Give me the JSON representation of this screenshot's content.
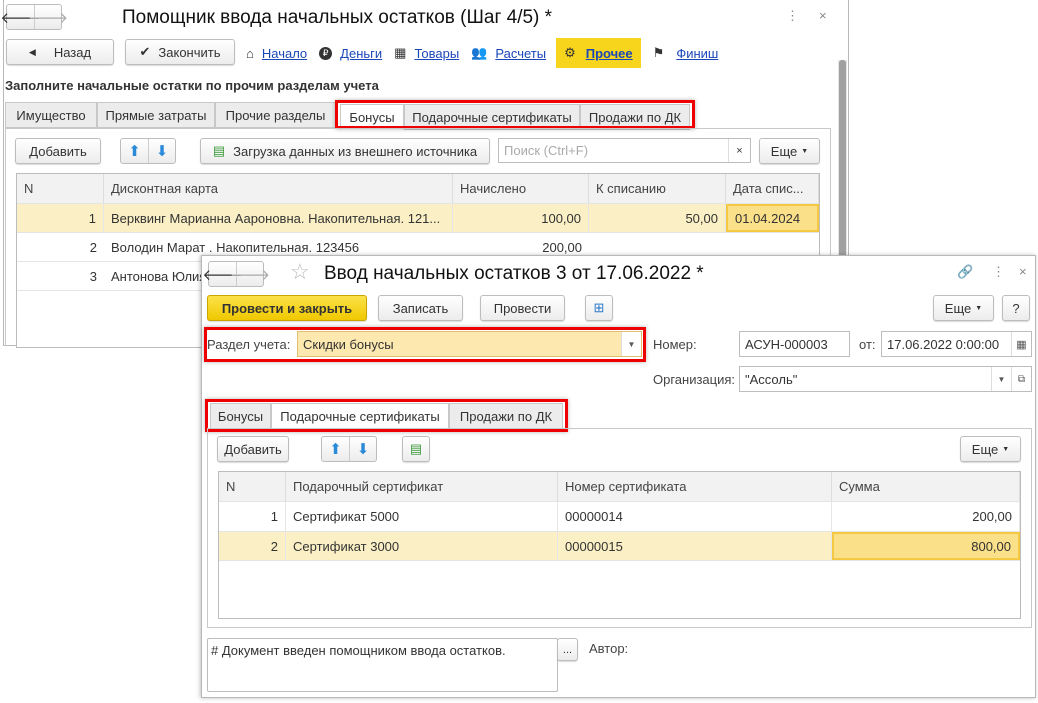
{
  "back": {
    "title": "Помощник ввода начальных остатков (Шаг 4/5) *",
    "back_btn": "Назад",
    "finish_btn": "Закончить",
    "steps": [
      {
        "label": "Начало",
        "icon": "home-icon"
      },
      {
        "label": "Деньги",
        "icon": "ruble-icon"
      },
      {
        "label": "Товары",
        "icon": "goods-icon"
      },
      {
        "label": "Расчеты",
        "icon": "people-icon"
      },
      {
        "label": "Прочее",
        "icon": "gear-icon",
        "active": true
      },
      {
        "label": "Финиш",
        "icon": "flag-icon"
      }
    ],
    "heading": "Заполните начальные остатки по прочим разделам учета",
    "tabs": [
      "Имущество",
      "Прямые затраты",
      "Прочие разделы",
      "Бонусы",
      "Подарочные сертификаты",
      "Продажи по ДК"
    ],
    "add_btn": "Добавить",
    "load_btn": "Загрузка данных из внешнего источника",
    "search_placeholder": "Поиск (Ctrl+F)",
    "more_btn": "Еще",
    "columns": [
      "N",
      "Дисконтная карта",
      "Начислено",
      "К списанию",
      "Дата спис..."
    ],
    "rows": [
      [
        "1",
        "Верквинг Марианна Аароновна. Накопительная. 121...",
        "100,00",
        "50,00",
        "01.04.2024"
      ],
      [
        "2",
        "Володин Марат . Накопительная. 123456",
        "200,00",
        "",
        ""
      ],
      [
        "3",
        "Антонова Юлия",
        "",
        "",
        ""
      ]
    ]
  },
  "front": {
    "title": "Ввод начальных остатков 3 от 17.06.2022 *",
    "post_close_btn": "Провести и закрыть",
    "save_btn": "Записать",
    "post_btn": "Провести",
    "more_btn": "Еще",
    "help_btn": "?",
    "section_label": "Раздел учета:",
    "section_value": "Скидки бонусы",
    "number_label": "Номер:",
    "number_value": "АСУН-000003",
    "date_label": "от:",
    "date_value": "17.06.2022  0:00:00",
    "org_label": "Организация:",
    "org_value": "\"Ассоль\"",
    "tabs": [
      "Бонусы",
      "Подарочные сертификаты",
      "Продажи по ДК"
    ],
    "add_btn": "Добавить",
    "columns": [
      "N",
      "Подарочный сертификат",
      "Номер сертификата",
      "Сумма"
    ],
    "rows": [
      [
        "1",
        "Сертификат 5000",
        "00000014",
        "200,00"
      ],
      [
        "2",
        "Сертификат 3000",
        "00000015",
        "800,00"
      ]
    ],
    "comment": "# Документ введен помощником ввода остатков.",
    "comment_btn": "...",
    "author_label": "Автор:"
  },
  "colors": {
    "accent_yellow": "#f7d51d",
    "highlight": "#e00000",
    "link": "#1a47b8"
  }
}
